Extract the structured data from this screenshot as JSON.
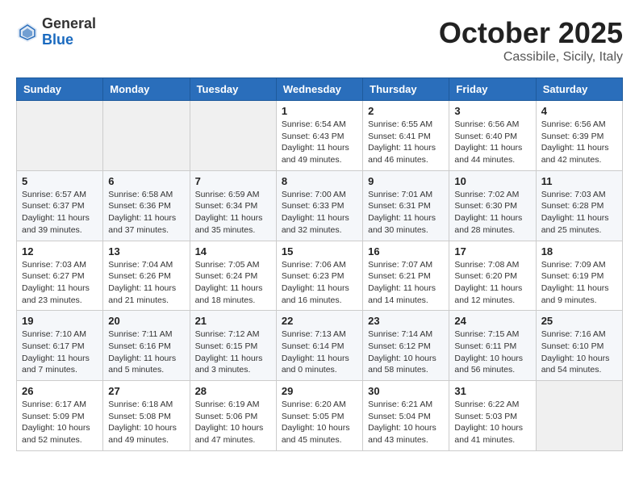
{
  "logo": {
    "general": "General",
    "blue": "Blue"
  },
  "title": "October 2025",
  "location": "Cassibile, Sicily, Italy",
  "days_of_week": [
    "Sunday",
    "Monday",
    "Tuesday",
    "Wednesday",
    "Thursday",
    "Friday",
    "Saturday"
  ],
  "weeks": [
    [
      {
        "day": "",
        "info": ""
      },
      {
        "day": "",
        "info": ""
      },
      {
        "day": "",
        "info": ""
      },
      {
        "day": "1",
        "info": "Sunrise: 6:54 AM\nSunset: 6:43 PM\nDaylight: 11 hours\nand 49 minutes."
      },
      {
        "day": "2",
        "info": "Sunrise: 6:55 AM\nSunset: 6:41 PM\nDaylight: 11 hours\nand 46 minutes."
      },
      {
        "day": "3",
        "info": "Sunrise: 6:56 AM\nSunset: 6:40 PM\nDaylight: 11 hours\nand 44 minutes."
      },
      {
        "day": "4",
        "info": "Sunrise: 6:56 AM\nSunset: 6:39 PM\nDaylight: 11 hours\nand 42 minutes."
      }
    ],
    [
      {
        "day": "5",
        "info": "Sunrise: 6:57 AM\nSunset: 6:37 PM\nDaylight: 11 hours\nand 39 minutes."
      },
      {
        "day": "6",
        "info": "Sunrise: 6:58 AM\nSunset: 6:36 PM\nDaylight: 11 hours\nand 37 minutes."
      },
      {
        "day": "7",
        "info": "Sunrise: 6:59 AM\nSunset: 6:34 PM\nDaylight: 11 hours\nand 35 minutes."
      },
      {
        "day": "8",
        "info": "Sunrise: 7:00 AM\nSunset: 6:33 PM\nDaylight: 11 hours\nand 32 minutes."
      },
      {
        "day": "9",
        "info": "Sunrise: 7:01 AM\nSunset: 6:31 PM\nDaylight: 11 hours\nand 30 minutes."
      },
      {
        "day": "10",
        "info": "Sunrise: 7:02 AM\nSunset: 6:30 PM\nDaylight: 11 hours\nand 28 minutes."
      },
      {
        "day": "11",
        "info": "Sunrise: 7:03 AM\nSunset: 6:28 PM\nDaylight: 11 hours\nand 25 minutes."
      }
    ],
    [
      {
        "day": "12",
        "info": "Sunrise: 7:03 AM\nSunset: 6:27 PM\nDaylight: 11 hours\nand 23 minutes."
      },
      {
        "day": "13",
        "info": "Sunrise: 7:04 AM\nSunset: 6:26 PM\nDaylight: 11 hours\nand 21 minutes."
      },
      {
        "day": "14",
        "info": "Sunrise: 7:05 AM\nSunset: 6:24 PM\nDaylight: 11 hours\nand 18 minutes."
      },
      {
        "day": "15",
        "info": "Sunrise: 7:06 AM\nSunset: 6:23 PM\nDaylight: 11 hours\nand 16 minutes."
      },
      {
        "day": "16",
        "info": "Sunrise: 7:07 AM\nSunset: 6:21 PM\nDaylight: 11 hours\nand 14 minutes."
      },
      {
        "day": "17",
        "info": "Sunrise: 7:08 AM\nSunset: 6:20 PM\nDaylight: 11 hours\nand 12 minutes."
      },
      {
        "day": "18",
        "info": "Sunrise: 7:09 AM\nSunset: 6:19 PM\nDaylight: 11 hours\nand 9 minutes."
      }
    ],
    [
      {
        "day": "19",
        "info": "Sunrise: 7:10 AM\nSunset: 6:17 PM\nDaylight: 11 hours\nand 7 minutes."
      },
      {
        "day": "20",
        "info": "Sunrise: 7:11 AM\nSunset: 6:16 PM\nDaylight: 11 hours\nand 5 minutes."
      },
      {
        "day": "21",
        "info": "Sunrise: 7:12 AM\nSunset: 6:15 PM\nDaylight: 11 hours\nand 3 minutes."
      },
      {
        "day": "22",
        "info": "Sunrise: 7:13 AM\nSunset: 6:14 PM\nDaylight: 11 hours\nand 0 minutes."
      },
      {
        "day": "23",
        "info": "Sunrise: 7:14 AM\nSunset: 6:12 PM\nDaylight: 10 hours\nand 58 minutes."
      },
      {
        "day": "24",
        "info": "Sunrise: 7:15 AM\nSunset: 6:11 PM\nDaylight: 10 hours\nand 56 minutes."
      },
      {
        "day": "25",
        "info": "Sunrise: 7:16 AM\nSunset: 6:10 PM\nDaylight: 10 hours\nand 54 minutes."
      }
    ],
    [
      {
        "day": "26",
        "info": "Sunrise: 6:17 AM\nSunset: 5:09 PM\nDaylight: 10 hours\nand 52 minutes."
      },
      {
        "day": "27",
        "info": "Sunrise: 6:18 AM\nSunset: 5:08 PM\nDaylight: 10 hours\nand 49 minutes."
      },
      {
        "day": "28",
        "info": "Sunrise: 6:19 AM\nSunset: 5:06 PM\nDaylight: 10 hours\nand 47 minutes."
      },
      {
        "day": "29",
        "info": "Sunrise: 6:20 AM\nSunset: 5:05 PM\nDaylight: 10 hours\nand 45 minutes."
      },
      {
        "day": "30",
        "info": "Sunrise: 6:21 AM\nSunset: 5:04 PM\nDaylight: 10 hours\nand 43 minutes."
      },
      {
        "day": "31",
        "info": "Sunrise: 6:22 AM\nSunset: 5:03 PM\nDaylight: 10 hours\nand 41 minutes."
      },
      {
        "day": "",
        "info": ""
      }
    ]
  ]
}
